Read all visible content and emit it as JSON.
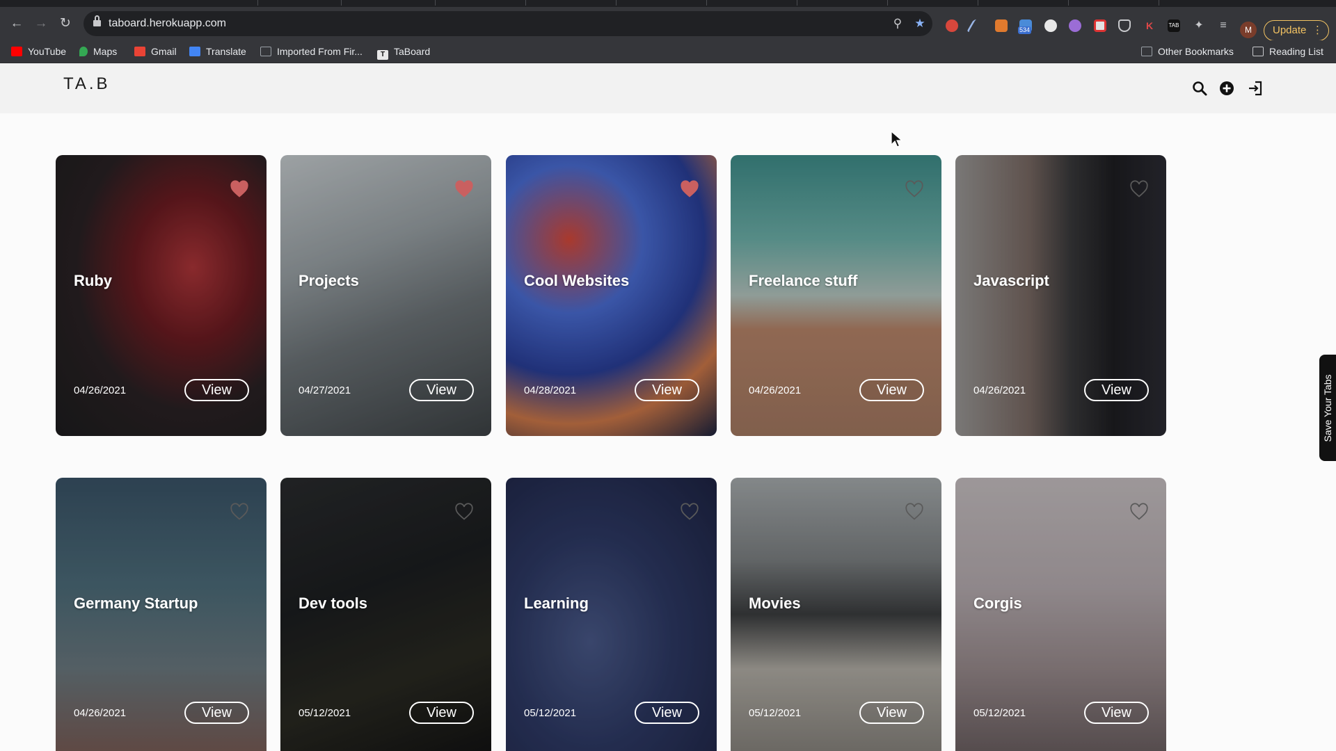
{
  "browser": {
    "url": "taboard.herokuapp.com",
    "update_label": "Update",
    "extension_badge": "534",
    "profile_initial": "M",
    "bookmarks": [
      {
        "label": "YouTube",
        "color": "#ff0000"
      },
      {
        "label": "Maps",
        "color": "#34a853"
      },
      {
        "label": "Gmail",
        "color": "#ea4335"
      },
      {
        "label": "Translate",
        "color": "#4285f4"
      },
      {
        "label": "Imported From Fir...",
        "color": "#9aa0a6"
      },
      {
        "label": "TaBoard",
        "color": "#111111"
      }
    ],
    "other_bookmarks": "Other Bookmarks",
    "reading_list": "Reading List"
  },
  "site": {
    "logo": "TA.B",
    "side_tab": "Save Your Tabs"
  },
  "cards": [
    {
      "title": "Ruby",
      "date": "04/26/2021",
      "view": "View",
      "favorited": true
    },
    {
      "title": "Projects",
      "date": "04/27/2021",
      "view": "View",
      "favorited": true
    },
    {
      "title": "Cool Websites",
      "date": "04/28/2021",
      "view": "View",
      "favorited": true
    },
    {
      "title": "Freelance stuff",
      "date": "04/26/2021",
      "view": "View",
      "favorited": false
    },
    {
      "title": "Javascript",
      "date": "04/26/2021",
      "view": "View",
      "favorited": false
    },
    {
      "title": "Germany Startup",
      "date": "04/26/2021",
      "view": "View",
      "favorited": false
    },
    {
      "title": "Dev tools",
      "date": "05/12/2021",
      "view": "View",
      "favorited": false
    },
    {
      "title": "Learning",
      "date": "05/12/2021",
      "view": "View",
      "favorited": false
    },
    {
      "title": "Movies",
      "date": "05/12/2021",
      "view": "View",
      "favorited": false
    },
    {
      "title": "Corgis",
      "date": "05/12/2021",
      "view": "View",
      "favorited": false
    }
  ],
  "colors": {
    "accent_update": "#f4c463",
    "heart_active": "#e06a6a"
  }
}
